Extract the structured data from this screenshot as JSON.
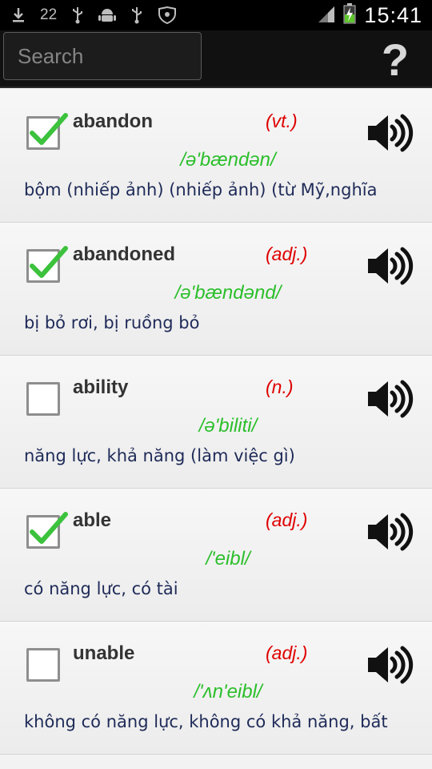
{
  "status_bar": {
    "notification_count": "22",
    "time": "15:41"
  },
  "action_bar": {
    "search_placeholder": "Search",
    "help_label": "?"
  },
  "entries": [
    {
      "word": "abandon",
      "pos": "(vt.)",
      "phonetic": "/ə'bændən/",
      "meaning": "bộm (nhiếp ảnh) (nhiếp ảnh) (từ Mỹ,nghĩa",
      "checked": true
    },
    {
      "word": "abandoned",
      "pos": "(adj.)",
      "phonetic": "/ə'bændənd/",
      "meaning": "bị bỏ rơi, bị ruồng bỏ",
      "checked": true
    },
    {
      "word": "ability",
      "pos": "(n.)",
      "phonetic": "/ə'biliti/",
      "meaning": "năng lực, khả năng (làm việc gì)",
      "checked": false
    },
    {
      "word": "able",
      "pos": "(adj.)",
      "phonetic": "/'eibl/",
      "meaning": "có năng lực, có tài",
      "checked": true
    },
    {
      "word": "unable",
      "pos": "(adj.)",
      "phonetic": "/'ʌn'eibl/",
      "meaning": "không có năng lực, không có khả năng, bất",
      "checked": false
    }
  ],
  "colors": {
    "pos_red": "#e00000",
    "phonetic_green": "#2bbf2b",
    "meaning_navy": "#1e2a58",
    "check_green": "#3cc23c"
  },
  "icons": {
    "speaker": "speaker-icon",
    "help": "question-mark-icon",
    "checkmark": "checkmark-icon"
  }
}
